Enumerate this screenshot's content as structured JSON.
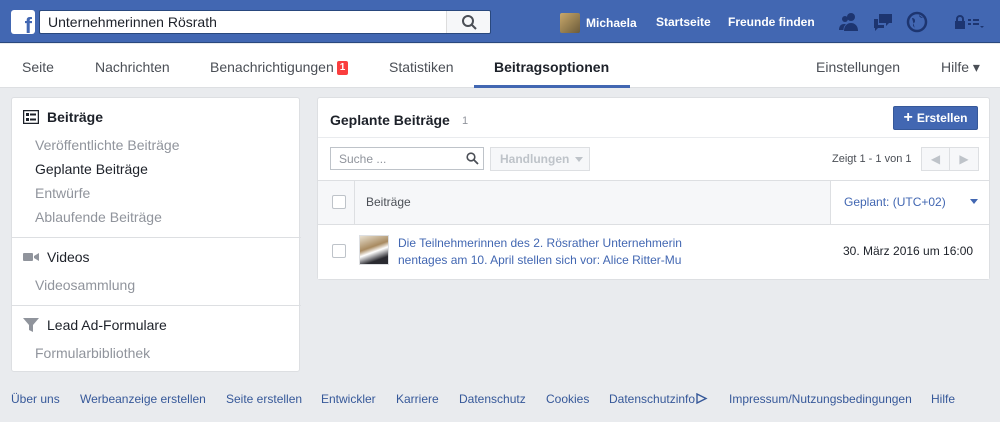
{
  "topbar": {
    "search_value": "Unternehmerinnen Rösrath",
    "user_name": "Michaela",
    "home_link": "Startseite",
    "find_friends_link": "Freunde finden",
    "icons": [
      "friends-icon",
      "messages-icon",
      "globe-notifications-icon",
      "privacy-lock-icon"
    ]
  },
  "pagenav": {
    "tabs": [
      {
        "label": "Seite"
      },
      {
        "label": "Nachrichten"
      },
      {
        "label": "Benachrichtigungen",
        "badge": "1"
      },
      {
        "label": "Statistiken"
      },
      {
        "label": "Beitragsoptionen",
        "active": true
      }
    ],
    "settings": "Einstellungen",
    "help": "Hilfe ▾"
  },
  "sidebar": {
    "posts_header": "Beiträge",
    "posts_items": [
      {
        "label": "Veröffentlichte Beiträge"
      },
      {
        "label": "Geplante Beiträge",
        "current": true
      },
      {
        "label": "Entwürfe"
      },
      {
        "label": "Ablaufende Beiträge"
      }
    ],
    "videos_header": "Videos",
    "videos_items": [
      {
        "label": "Videosammlung"
      }
    ],
    "leads_header": "Lead Ad-Formulare",
    "leads_items": [
      {
        "label": "Formularbibliothek"
      }
    ]
  },
  "main": {
    "title": "Geplante Beiträge",
    "count": "1",
    "create_button": "Erstellen",
    "search_placeholder": "Suche ...",
    "actions_dropdown": "Handlungen",
    "paging": "Zeigt 1 - 1 von 1",
    "pager_prev": "◀",
    "pager_next": "▶",
    "table": {
      "col_posts": "Beiträge",
      "col_scheduled": "Geplant: (UTC+02)",
      "rows": [
        {
          "text_line1": "Die Teilnehmerinnen des 2. Rösrather Unternehmerin",
          "text_line2": "nentages am 10. April stellen sich vor: Alice Ritter-Mu",
          "date": "30. März 2016 um 16:00"
        }
      ]
    }
  },
  "footer": {
    "links": [
      "Über uns",
      "Werbeanzeige erstellen",
      "Seite erstellen",
      "Entwickler",
      "Karriere",
      "Datenschutz",
      "Cookies",
      "Datenschutzinfo",
      "Impressum/Nutzungsbedingungen",
      "Hilfe"
    ]
  },
  "colors": {
    "brand_blue": "#4267b2",
    "badge_red": "#fa3e3e",
    "background": "#e9ebee"
  }
}
